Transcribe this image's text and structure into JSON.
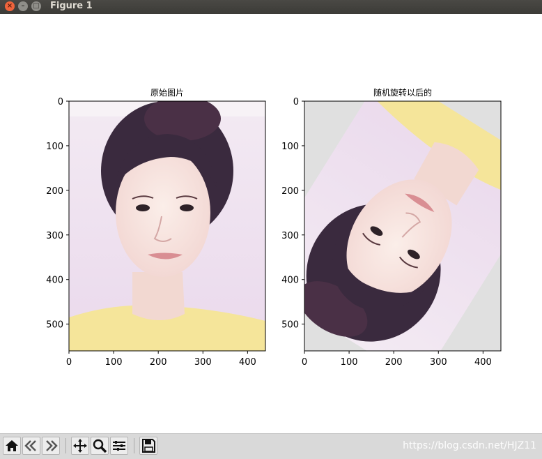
{
  "window": {
    "title": "Figure 1"
  },
  "chart_data": [
    {
      "type": "image",
      "title": "原始图片",
      "x_ticks": [
        "0",
        "100",
        "200",
        "300",
        "400"
      ],
      "y_ticks": [
        "0",
        "100",
        "200",
        "300",
        "400",
        "500"
      ],
      "xlim": [
        0,
        440
      ],
      "ylim": [
        560,
        0
      ]
    },
    {
      "type": "image",
      "title": "随机旋转以后的",
      "x_ticks": [
        "0",
        "100",
        "200",
        "300",
        "400"
      ],
      "y_ticks": [
        "0",
        "100",
        "200",
        "300",
        "400",
        "500"
      ],
      "xlim": [
        0,
        440
      ],
      "ylim": [
        560,
        0
      ]
    }
  ],
  "toolbar": {
    "buttons": [
      "home-icon",
      "back-icon",
      "forward-icon",
      "pan-icon",
      "zoom-icon",
      "configure-icon",
      "save-icon"
    ]
  },
  "watermark": "https://blog.csdn.net/HJZ11"
}
